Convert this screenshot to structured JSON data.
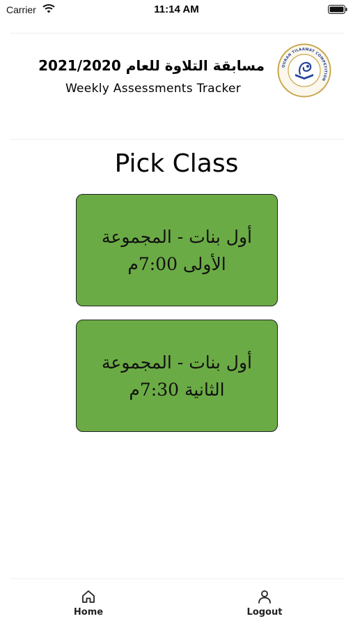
{
  "status_bar": {
    "carrier": "Carrier",
    "time": "11:14 AM"
  },
  "header": {
    "arabic_title": "مسابقة التلاوة للعام 2021/2020",
    "subtitle": "Weekly Assessments Tracker",
    "logo_text": "QURAN TILAAWAT COMPETITION"
  },
  "page": {
    "title": "Pick Class"
  },
  "classes": [
    {
      "label": "أول بنات - المجموعة الأولى 7:00م"
    },
    {
      "label": "أول بنات - المجموعة الثانية 7:30م"
    }
  ],
  "tabs": [
    {
      "label": "Home",
      "icon": "home-icon"
    },
    {
      "label": "Logout",
      "icon": "user-icon"
    }
  ],
  "colors": {
    "card": "#6bab45",
    "card_border": "#222222",
    "logo_ring": "#c9a64a",
    "logo_ink": "#27459a"
  }
}
